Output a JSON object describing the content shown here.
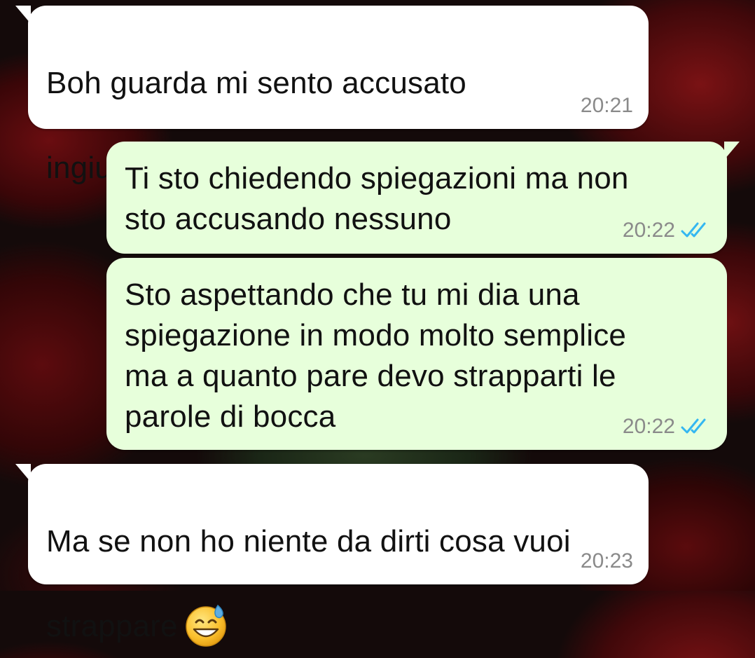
{
  "messages": [
    {
      "direction": "incoming",
      "text": "Boh guarda mi sento accusato\ningiustamente",
      "emoji": "grinning-sweat-emoji",
      "time": "20:21"
    },
    {
      "direction": "outgoing",
      "text": "Ti sto chiedendo spiegazioni ma non\nsto accusando nessuno",
      "time": "20:22",
      "status_icon": "double-check-read-icon",
      "status_color": "#34b7f1"
    },
    {
      "direction": "outgoing",
      "text": "Sto aspettando che tu mi dia una\nspiegazione in modo molto semplice\nma a quanto pare devo strapparti le\nparole di bocca",
      "time": "20:22",
      "status_icon": "double-check-read-icon",
      "status_color": "#34b7f1"
    },
    {
      "direction": "incoming",
      "text": "Ma se non ho niente da dirti cosa vuoi\nstrappare",
      "emoji": "grinning-sweat-emoji",
      "time": "20:23"
    }
  ],
  "colors": {
    "incoming_bubble": "#ffffff",
    "outgoing_bubble": "#e7ffdb",
    "timestamp": "#8a8a8a",
    "read_ticks": "#34b7f1"
  }
}
